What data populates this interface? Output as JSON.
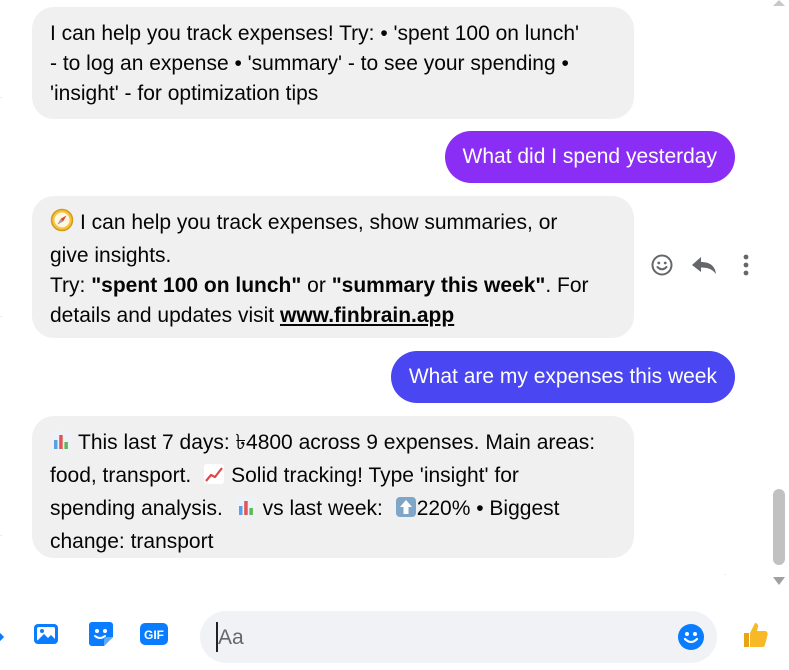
{
  "messages": {
    "bot1": {
      "line1": "I can help you track expenses! Try: • 'spent 100 on lunch'",
      "line2": "- to log an expense • 'summary' - to see your spending •",
      "line3": "'insight' - for optimization tips"
    },
    "user1": "What did I spend yesterday",
    "bot2": {
      "line1": "I can help you track expenses, show summaries, or",
      "line2": "give insights.",
      "try": "Try: ",
      "ex1": "\"spent 100 on lunch\"",
      "or": " or ",
      "ex2": "\"summary this week\"",
      "for": ". For",
      "details": "details and updates visit ",
      "link": "www.finbrain.app"
    },
    "user2": "What are my expenses this week",
    "bot3": {
      "line1": "This last 7 days: ৳4800 across 9 expenses. Main areas:",
      "line2a": "food, transport.",
      "line2b": "Solid tracking! Type 'insight' for",
      "line3a": "spending analysis.",
      "line3b": "vs last week:",
      "line3c": "220% • Biggest",
      "line4": "change: transport"
    }
  },
  "icons": {
    "bot2_leading": "compass-icon",
    "bot3_leading": "bar-chart-icon",
    "trend": "chart-increasing-icon",
    "up": "up-arrow-icon"
  },
  "composer": {
    "placeholder": "Aa"
  },
  "colors": {
    "user1_bubble": "#8a2ef5",
    "user2_bubble": "#4a46f2",
    "bot_bubble": "#f0f0f0",
    "icon_blue": "#0a7cff",
    "like_yellow": "#f7b928"
  }
}
